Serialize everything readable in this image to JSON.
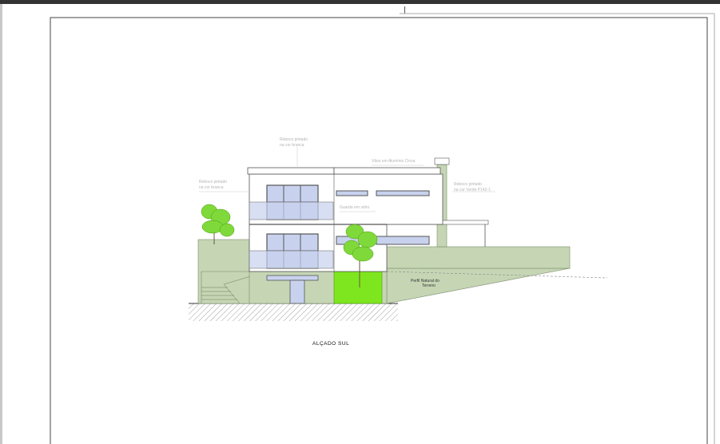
{
  "drawing": {
    "title": "ALÇADO SUL",
    "annotations": {
      "roof_top_1": "Reboco pintado",
      "roof_top_2": "na cor branca",
      "left_1": "Reboco pintado",
      "left_2": "na cor branca",
      "frames": "Vãos em Alumínio Cinza",
      "right_1": "Reboco pintado",
      "right_2": "na cor Verde P142-1",
      "guard": "Guarda em vidro",
      "terrain_1": "Perfil Natural do",
      "terrain_2": "Terreno"
    }
  },
  "colors": {
    "wall_white": "#ffffff",
    "wall_green": "#c6d6b5",
    "glass": "#c8d2ee",
    "frame": "#555555",
    "lawn": "#7ee61e",
    "tree": "#7fd93a"
  }
}
